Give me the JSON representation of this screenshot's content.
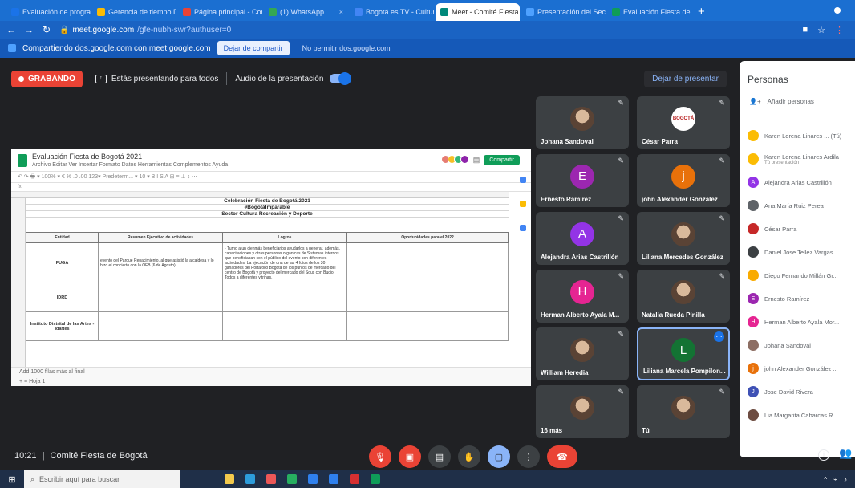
{
  "browser": {
    "tabs": [
      {
        "label": "Evaluación de programa",
        "color": "#1a73e8"
      },
      {
        "label": "Gerencia de tiempo De",
        "color": "#fbbc04"
      },
      {
        "label": "Página principal - Correo",
        "color": "#ea4335"
      },
      {
        "label": "(1) WhatsApp",
        "color": "#34a853"
      },
      {
        "label": "Bogotá es TV - Cultura",
        "color": "#4285f4"
      },
      {
        "label": "Meet - Comité Fiesta",
        "color": "#00897b",
        "active": true
      },
      {
        "label": "Presentación del Sector Fi",
        "color": "#4ea1ff"
      },
      {
        "label": "Evaluación Fiesta de Bog",
        "color": "#0f9d58"
      }
    ],
    "new_tab": "+",
    "url_host": "meet.google.com",
    "url_path": "/gfe-nubh-swr?authuser=0",
    "share_notice": "Compartiendo dos.google.com con meet.google.com",
    "stop_sharing": "Dejar de compartir",
    "hide_bar": "No permitir dos.google.com"
  },
  "meet": {
    "recording": "GRABANDO",
    "presenting_text": "Estás presentando para todos",
    "audio_text": "Audio de la presentación",
    "stop_presenting": "Dejar de presentar",
    "time": "10:21",
    "meeting_name": "Comité Fiesta de Bogotá",
    "separator": "|"
  },
  "sheet": {
    "title": "Evaluación Fiesta de Bogotá 2021",
    "menu": "Archivo  Editar  Ver  Insertar  Formato  Datos  Herramientas  Complementos  Ayuda",
    "share": "Compartir",
    "title_rows": [
      "Celebración Fiesta de Bogotá 2021",
      "#BogotáImparable",
      "Sector Cultura Recreación y Deporte"
    ],
    "headers": [
      "Entidad",
      "Resumen Ejecutivo de actividades",
      "Logros",
      "Oportunidades para el 2022"
    ],
    "rows": [
      {
        "entity": "FUGA",
        "summary": "evento del Parque Renacimiento, al que asistió la alcaldesa y lo hizo el concierto con la OFB (6 de Agosto).",
        "logros": "- Turno a un cienmás beneficiarios ayudarlos a generar, además, capacitaciones y otras personas orgánicas de Sistemas internos que beneficiaban con el público del evento con diferentes actividades. La ejecución de una de las 4 fotos de los 30 ganadores del Portafolio Bogotá de los puntos de mercado del centro de Bogotá y proyecto del mercado del Sous con Bucio. Todos a diferentes vitrinas."
      },
      {
        "entity": "IDRD",
        "summary": "",
        "logros": ""
      },
      {
        "entity": "Instituto Distrital de las Artes - Idartes",
        "summary": "",
        "logros": ""
      }
    ],
    "bottom_left": "Add    1000    filas más al final",
    "sheet_tab": "Hoja 1"
  },
  "tiles": [
    {
      "name": "Johana Sandoval",
      "initial": "",
      "color": "",
      "photo": true
    },
    {
      "name": "César Parra",
      "initial": "",
      "color": "#b71c1c",
      "photo": false,
      "logo": "BOGOTÁ"
    },
    {
      "name": "Ernesto Ramírez",
      "initial": "E",
      "color": "#9c27b0"
    },
    {
      "name": "john Alexander González",
      "initial": "j",
      "color": "#e8710a"
    },
    {
      "name": "Alejandra Arias Castrillón",
      "initial": "A",
      "color": "#9334e6"
    },
    {
      "name": "Liliana Mercedes González",
      "initial": "",
      "color": "",
      "photo": true
    },
    {
      "name": "Herman Alberto Ayala M...",
      "initial": "H",
      "color": "#e52592"
    },
    {
      "name": "Natalia Rueda Pinilla",
      "initial": "",
      "color": "",
      "photo": true
    },
    {
      "name": "William Heredia",
      "initial": "",
      "color": "",
      "photo": true
    },
    {
      "name": "Liliana Marcela Pompilon...",
      "initial": "L",
      "color": "#137333",
      "active": true
    },
    {
      "name": "16 más",
      "initial": "",
      "color": "",
      "photo": true
    },
    {
      "name": "Tú",
      "initial": "",
      "color": "",
      "photo": true
    }
  ],
  "people": {
    "title": "Personas",
    "add": "Añadir personas",
    "list": [
      {
        "name": "Karen Lorena Linares ... (Tú)",
        "sub": "",
        "color": "#fbbc04",
        "initial": ""
      },
      {
        "name": "Karen Lorena Linares Ardila",
        "sub": "Tú presentación",
        "color": "#fbbc04",
        "initial": ""
      },
      {
        "name": "Alejandra Arias Castrillón",
        "sub": "",
        "color": "#9334e6",
        "initial": "A"
      },
      {
        "name": "Ana María Ruiz Perea",
        "sub": "",
        "color": "#5f6368",
        "initial": ""
      },
      {
        "name": "César Parra",
        "sub": "",
        "color": "#c62828",
        "initial": ""
      },
      {
        "name": "Daniel Jose Tellez Vargas",
        "sub": "",
        "color": "#3c4043",
        "initial": ""
      },
      {
        "name": "Diego Fernando Millán Gr...",
        "sub": "",
        "color": "#f9ab00",
        "initial": ""
      },
      {
        "name": "Ernesto Ramírez",
        "sub": "",
        "color": "#9c27b0",
        "initial": "E"
      },
      {
        "name": "Herman Alberto Ayala Mor...",
        "sub": "",
        "color": "#e52592",
        "initial": "H"
      },
      {
        "name": "Johana Sandoval",
        "sub": "",
        "color": "#8d6e63",
        "initial": ""
      },
      {
        "name": "john Alexander González ...",
        "sub": "",
        "color": "#e8710a",
        "initial": "j"
      },
      {
        "name": "Jose David Rivera",
        "sub": "",
        "color": "#3f51b5",
        "initial": "J"
      },
      {
        "name": "Lia Margarita Cabarcas R...",
        "sub": "",
        "color": "#6d4c41",
        "initial": ""
      }
    ]
  },
  "taskbar": {
    "search": "Escribir aquí para buscar"
  }
}
